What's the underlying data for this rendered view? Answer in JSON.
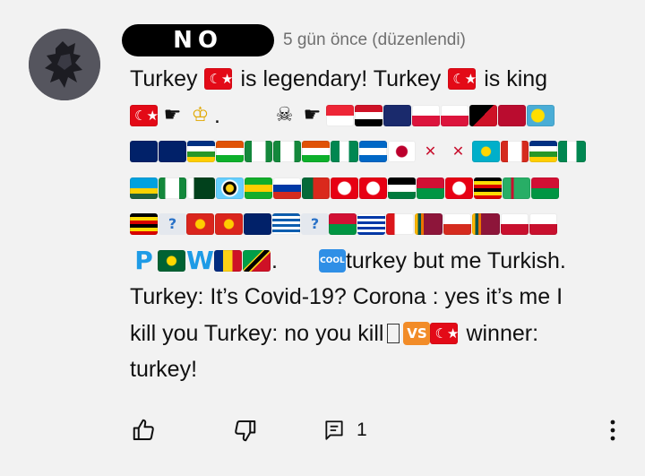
{
  "comment": {
    "author": "NO",
    "timestamp": "5 gün önce (düzenlendi)",
    "text_segments": {
      "l1_a": "Turkey",
      "l1_b": "is legendary! Turkey",
      "l1_c": "is king",
      "l2_dot": ".",
      "l6_dot": ".",
      "l6_text": "turkey  but me Turkish.",
      "l7": "Turkey: It’s Covid-19?  Corona : yes it’s me  I",
      "l8_a": "kill you  Turkey: no you kill",
      "l8_b": "winner:",
      "l9": "turkey!",
      "vs_label": "VS",
      "cool_label": "COOL",
      "p_letter": "P",
      "w_letter": "W",
      "q_mark": "?"
    },
    "emoji_icons": [
      "turkey-flag-icon",
      "pointing-right-icon",
      "crown-icon",
      "skull-crossbones-icon",
      "vs-button-icon",
      "cool-button-icon"
    ],
    "reply_count": "1"
  },
  "colors": {
    "background": "#f2f2f2",
    "timestamp": "#6f6f6f",
    "text": "#111111"
  }
}
